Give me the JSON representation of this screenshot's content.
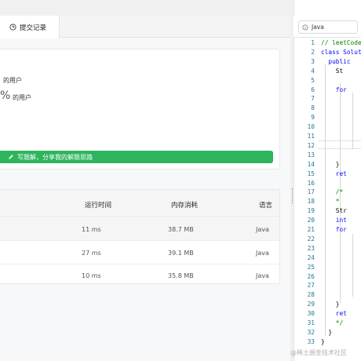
{
  "tabs": {
    "submissions_label": "提交记录"
  },
  "result": {
    "runtime_beat_suffix": "的用户",
    "memory_percent_sign": "%",
    "memory_beat_suffix": "的用户"
  },
  "share_solution_label": "写题解，分享我的解题思路",
  "table": {
    "headers": {
      "runtime": "运行时间",
      "memory": "内存消耗",
      "language": "语言"
    },
    "rows": [
      {
        "runtime": "11 ms",
        "memory": "38.7 MB",
        "language": "Java"
      },
      {
        "runtime": "27 ms",
        "memory": "39.1 MB",
        "language": "Java"
      },
      {
        "runtime": "10 ms",
        "memory": "35.8 MB",
        "language": "Java"
      }
    ]
  },
  "editor": {
    "language": "Java",
    "line_numbers": [
      "1",
      "2",
      "3",
      "4",
      "5",
      "6",
      "7",
      "8",
      "9",
      "10",
      "11",
      "12",
      "13",
      "14",
      "15",
      "16",
      "17",
      "18",
      "19",
      "20",
      "21",
      "22",
      "23",
      "24",
      "25",
      "26",
      "27",
      "28",
      "29",
      "30",
      "31",
      "32",
      "33"
    ],
    "visible_lines": {
      "1": "// leetCode",
      "2": "class Soluti",
      "3": "public",
      "4": "St",
      "6": "for",
      "14": "}",
      "15": "ret",
      "17": "/*",
      "18": "*",
      "19": "Str",
      "20": "int",
      "21": "for",
      "29": "}",
      "30": "ret",
      "31": "*/",
      "32": "}",
      "33": "}"
    },
    "current_line": "12"
  },
  "watermark": "@稀土掘金技术社区",
  "colors": {
    "accent_green": "#2db55d",
    "line_number": "#237893",
    "keyword": "#0000ff",
    "comment": "#008000"
  }
}
